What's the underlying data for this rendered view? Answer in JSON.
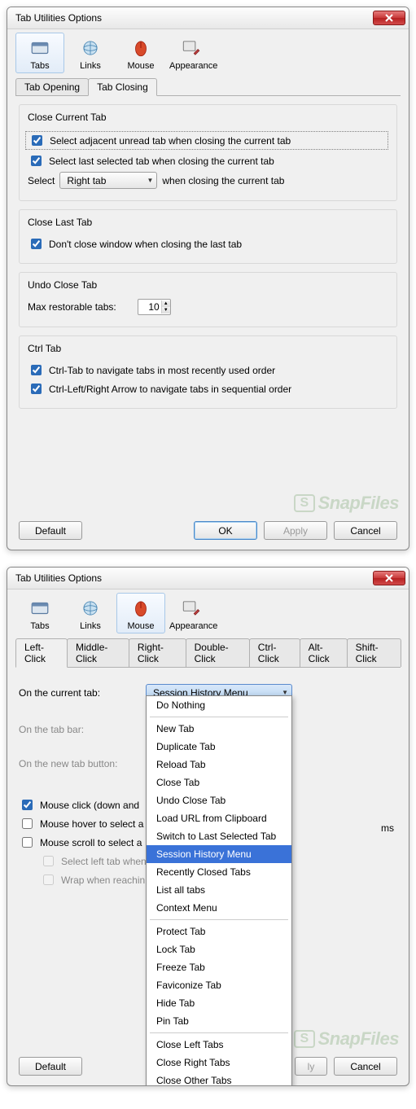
{
  "dialog1": {
    "title": "Tab Utilities Options",
    "toolbar": [
      {
        "label": "Tabs",
        "icon": "tabs"
      },
      {
        "label": "Links",
        "icon": "links"
      },
      {
        "label": "Mouse",
        "icon": "mouse"
      },
      {
        "label": "Appearance",
        "icon": "appearance"
      }
    ],
    "subtabs": {
      "opening": "Tab Opening",
      "closing": "Tab Closing"
    },
    "closeCurrent": {
      "title": "Close Current Tab",
      "adjacent": "Select adjacent unread tab when closing the current tab",
      "lastSelected": "Select last selected tab when closing the current tab",
      "selectLabel": "Select",
      "selectValue": "Right tab",
      "selectSuffix": "when closing the current tab"
    },
    "closeLast": {
      "title": "Close Last Tab",
      "dontClose": "Don't close window when closing the last tab"
    },
    "undo": {
      "title": "Undo Close Tab",
      "maxLabel": "Max restorable tabs:",
      "maxValue": "10"
    },
    "ctrlTab": {
      "title": "Ctrl Tab",
      "mru": "Ctrl-Tab to navigate tabs in most recently used order",
      "arrows": "Ctrl-Left/Right Arrow to navigate tabs in sequential order"
    },
    "buttons": {
      "default": "Default",
      "ok": "OK",
      "apply": "Apply",
      "cancel": "Cancel"
    },
    "watermark": "SnapFiles"
  },
  "dialog2": {
    "title": "Tab Utilities Options",
    "subtabs": [
      "Left-Click",
      "Middle-Click",
      "Right-Click",
      "Double-Click",
      "Ctrl-Click",
      "Alt-Click",
      "Shift-Click"
    ],
    "rows": {
      "currentTab": "On the current tab:",
      "currentValue": "Session History Menu",
      "tabBar": "On the tab bar:",
      "newTabButton": "On the new tab button:"
    },
    "checks": {
      "click": "Mouse click (down and",
      "hover": "Mouse hover to select a",
      "hoverSuffix": "ms",
      "scroll": "Mouse scroll to select a",
      "selectLeft": "Select left tab when",
      "wrap": "Wrap when reachin"
    },
    "dropdown": [
      "Do Nothing",
      "New Tab",
      "Duplicate Tab",
      "Reload Tab",
      "Close Tab",
      "Undo Close Tab",
      "Load URL from Clipboard",
      "Switch to Last Selected Tab",
      "Session History Menu",
      "Recently Closed Tabs",
      "List all tabs",
      "Context Menu",
      "Protect Tab",
      "Lock Tab",
      "Freeze Tab",
      "Faviconize Tab",
      "Hide Tab",
      "Pin Tab",
      "Close Left Tabs",
      "Close Right Tabs",
      "Close Other Tabs"
    ],
    "dropdown_selected": "Session History Menu",
    "buttons": {
      "default": "Default",
      "apply": "ly",
      "cancel": "Cancel"
    },
    "watermark": "SnapFiles"
  }
}
